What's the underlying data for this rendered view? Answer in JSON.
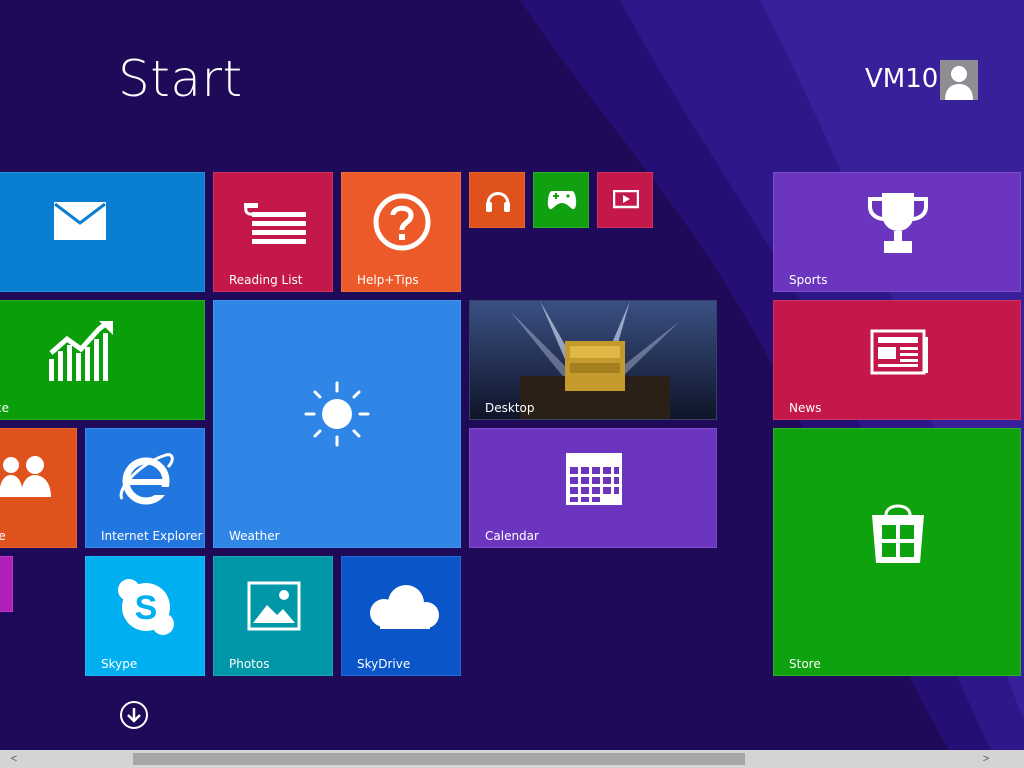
{
  "header": {
    "title": "Start",
    "user_name": "VM10"
  },
  "tiles": {
    "mail": {
      "label": ""
    },
    "finance": {
      "label": "ce"
    },
    "people": {
      "label": "le"
    },
    "reading_list": {
      "label": "Reading List"
    },
    "help_tips": {
      "label": "Help+Tips"
    },
    "weather": {
      "label": "Weather"
    },
    "internet_explorer": {
      "label": "Internet Explorer"
    },
    "skype": {
      "label": "Skype"
    },
    "photos": {
      "label": "Photos"
    },
    "skydrive": {
      "label": "SkyDrive"
    },
    "desktop": {
      "label": "Desktop"
    },
    "calendar": {
      "label": "Calendar"
    },
    "sports": {
      "label": "Sports"
    },
    "news": {
      "label": "News"
    },
    "store": {
      "label": "Store"
    }
  },
  "colors": {
    "background": "#1f0a5a",
    "mail": "#0a7fd1",
    "finance": "#0a9e0a",
    "people": "#e0521b",
    "reading_list": "#c4184a",
    "help_tips": "#ec5a29",
    "music": "#e0521b",
    "games": "#10a010",
    "video": "#c4184a",
    "weather": "#2f86e6",
    "internet_explorer": "#2276e0",
    "skype": "#00aff0",
    "photos": "#0097a8",
    "skydrive": "#0a55c8",
    "calendar": "#6c35c0",
    "sports": "#6c35c0",
    "news": "#c4184a",
    "store": "#0ea30e",
    "purple_edge": "#b01fb8"
  },
  "icons": {
    "mail": "envelope-icon",
    "finance": "chart-icon",
    "people": "people-icon",
    "reading_list": "reading-list-icon",
    "help_tips": "question-icon",
    "music": "headphones-icon",
    "games": "controller-icon",
    "video": "video-icon",
    "weather": "sun-icon",
    "internet_explorer": "ie-icon",
    "skype": "skype-icon",
    "photos": "photo-icon",
    "skydrive": "cloud-icon",
    "calendar": "calendar-icon",
    "sports": "trophy-icon",
    "news": "newspaper-icon",
    "store": "shopping-bag-icon",
    "apps": "arrow-down-circle-icon"
  },
  "scrollbar": {
    "left_arrow": "<",
    "right_arrow": ">"
  }
}
